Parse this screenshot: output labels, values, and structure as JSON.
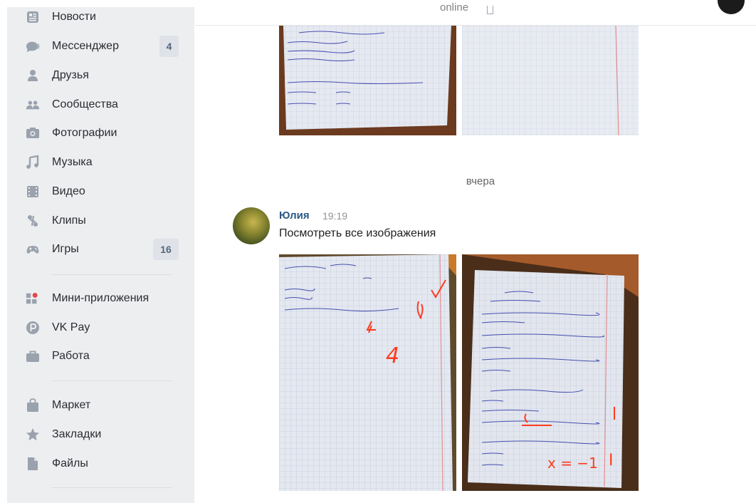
{
  "sidebar": {
    "items": [
      {
        "label": "Новости",
        "icon": "news-icon"
      },
      {
        "label": "Мессенджер",
        "icon": "message-icon",
        "badge": "4"
      },
      {
        "label": "Друзья",
        "icon": "user-icon"
      },
      {
        "label": "Сообщества",
        "icon": "users-icon"
      },
      {
        "label": "Фотографии",
        "icon": "camera-icon"
      },
      {
        "label": "Музыка",
        "icon": "music-note-icon"
      },
      {
        "label": "Видео",
        "icon": "film-icon"
      },
      {
        "label": "Клипы",
        "icon": "clips-icon"
      },
      {
        "label": "Игры",
        "icon": "gamepad-icon",
        "badge": "16"
      },
      {
        "label": "Мини-приложения",
        "icon": "apps-icon"
      },
      {
        "label": "VK Pay",
        "icon": "vkpay-icon"
      },
      {
        "label": "Работа",
        "icon": "briefcase-icon"
      },
      {
        "label": "Маркет",
        "icon": "shopping-bag-icon"
      },
      {
        "label": "Закладки",
        "icon": "star-icon"
      },
      {
        "label": "Файлы",
        "icon": "file-icon"
      }
    ]
  },
  "header": {
    "status_text": "online"
  },
  "chat": {
    "day_separator": "вчера",
    "message": {
      "author": "Юлия",
      "time": "19:19",
      "text": "Посмотреть все изображения"
    },
    "photo_annotations": {
      "grade": "4",
      "equation": "x = −1",
      "tick": "I"
    }
  },
  "colors": {
    "sidebar_bg": "#edeef0",
    "nav_icon": "#99a2ad",
    "link": "#2a5885",
    "badge_bg": "#dfe2e8",
    "badge_text": "#55677d",
    "red_pen": "#ff3b1f",
    "notification_dot": "#e64646"
  }
}
